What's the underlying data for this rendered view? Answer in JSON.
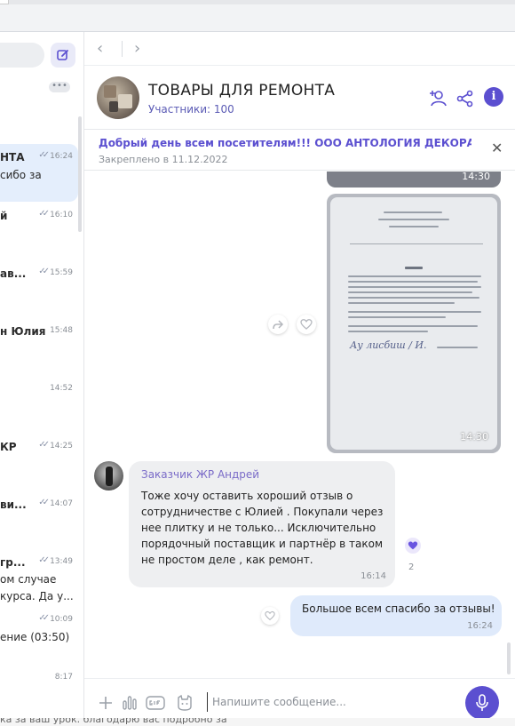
{
  "colors": {
    "accent": "#5b4fd0",
    "outgoing_bubble": "#dfeafb",
    "incoming_bubble": "#eeeff1"
  },
  "sidebar": {
    "chats": [
      {
        "name": "НТА",
        "time": "16:24",
        "preview": "сибо за"
      },
      {
        "name": "й",
        "time": "16:10",
        "preview": ""
      },
      {
        "name": "ав...",
        "time": "15:59",
        "preview": ""
      },
      {
        "name": "н Юлия",
        "time": "15:48",
        "preview": ""
      },
      {
        "name": "",
        "time": "14:52",
        "preview": ""
      },
      {
        "name": "КР",
        "time": "14:25",
        "preview": ""
      },
      {
        "name": "ви...",
        "time": "14:07",
        "preview": ""
      },
      {
        "name": "гр...",
        "time": "13:49",
        "preview": "ом случае",
        "preview2": "курса. Да у..."
      },
      {
        "name": "",
        "time": "10:09",
        "preview": "ение (03:50)"
      },
      {
        "name": "",
        "time": "8:17",
        "preview": ""
      }
    ],
    "menu_dots": "•••"
  },
  "header": {
    "title": "ТОВАРЫ ДЛЯ РЕМОНТА",
    "members": "Участники: 100"
  },
  "pinned": {
    "text": "Добрый день всем посетителям!!!   ООО АНТОЛОГИЯ ДЕКОРА з...",
    "date": "Закреплено в 11.12.2022"
  },
  "messages": [
    {
      "type": "image",
      "time": "14:30"
    },
    {
      "type": "image",
      "time": "14:30",
      "caption": "ОТЗЫВ",
      "signature": "Ау лисбиш / И."
    },
    {
      "type": "incoming",
      "author": "Заказчик ЖР Андрей",
      "text": "Тоже хочу оставить хороший отзыв  о сотрудничестве с Юлией . Покупали через нее плитку и не только... Исключительно порядочный  поставщик и партнёр в таком не простом деле , как ремонт.",
      "time": "16:14",
      "reaction_count": "2"
    },
    {
      "type": "outgoing",
      "text": "Большое всем спасибо за отзывы!",
      "time": "16:24"
    }
  ],
  "composer": {
    "placeholder": "Напишите сообщение..."
  },
  "bottom_strip": "ка за ваш урок. благодарю вас подробно за"
}
